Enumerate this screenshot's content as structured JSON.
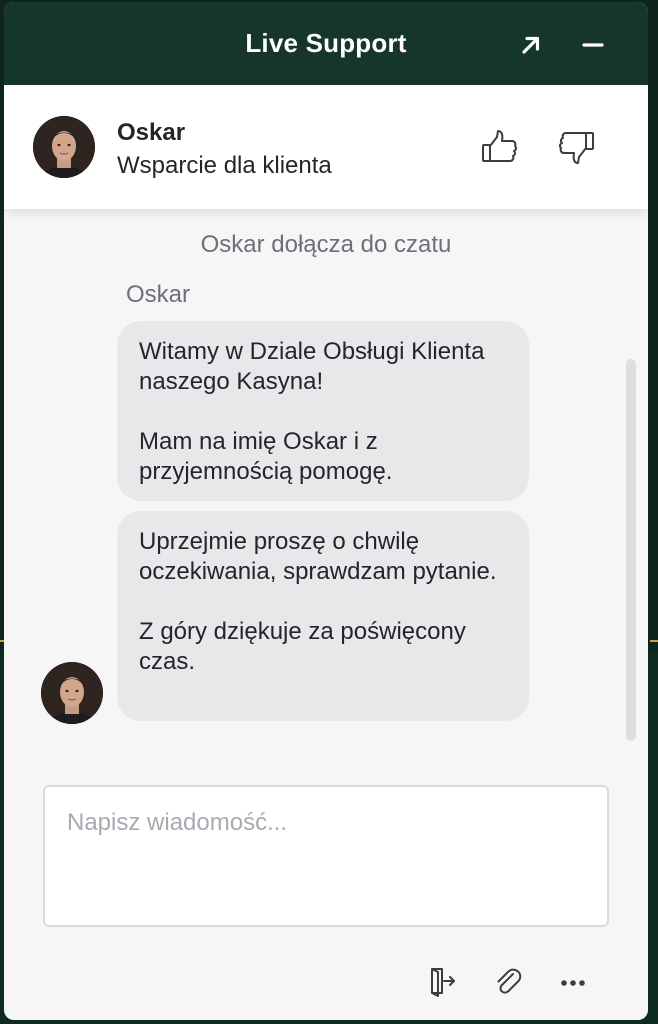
{
  "window": {
    "title": "Live Support"
  },
  "agent": {
    "name": "Oskar",
    "role": "Wsparcie dla klienta"
  },
  "messages": {
    "system_notice": "Oskar dołącza do czatu",
    "sender_name": "Oskar",
    "items": [
      {
        "text": "Witamy w Dziale Obsługi Klienta naszego Kasyna!\n\nMam na imię Oskar i z przyjemnością pomogę."
      },
      {
        "text": "Uprzejmie proszę o chwilę oczekiwania, sprawdzam pytanie.\n\nZ góry dziękuje za poświęcony czas."
      }
    ]
  },
  "composer": {
    "placeholder": "Napisz wiadomość..."
  },
  "icons": {
    "expand": "arrow-up-right-icon",
    "minimize": "minus-icon",
    "rate_up": "thumbs-up-icon",
    "rate_down": "thumbs-down-icon",
    "exit": "exit-chat-icon",
    "attach": "paperclip-icon",
    "more": "more-dots-icon"
  },
  "colors": {
    "header": "#163629",
    "bubble": "#e8e8ea",
    "panel": "#f6f6f7"
  }
}
